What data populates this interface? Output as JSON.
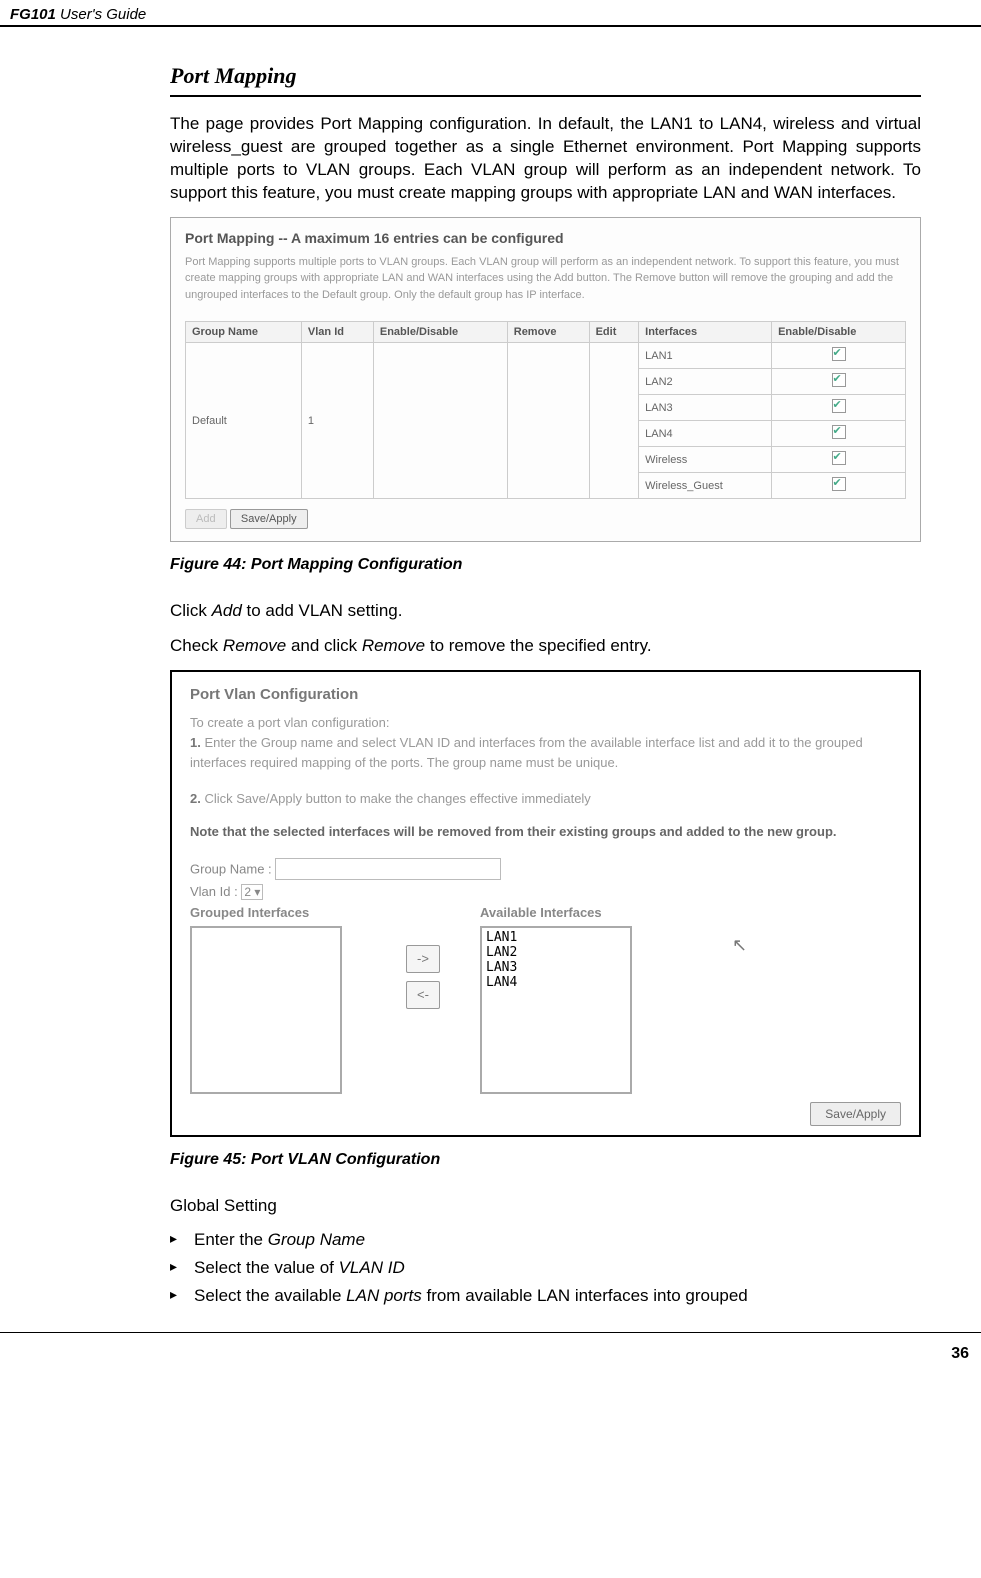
{
  "header": {
    "product": "FG101",
    "book": "User's Guide"
  },
  "section": {
    "heading": "Port Mapping"
  },
  "intro": "The page provides Port Mapping configuration. In default, the LAN1 to LAN4, wireless and virtual wireless_guest are grouped together as a single Ethernet environment. Port Mapping supports multiple ports to VLAN groups. Each VLAN group will perform as an independent network. To support this feature, you must create mapping groups with appropriate LAN and WAN interfaces.",
  "shot1": {
    "title": "Port Mapping -- A maximum 16 entries can be configured",
    "desc": "Port Mapping supports multiple ports to VLAN groups. Each VLAN group will perform as an independent network. To support this feature, you must create mapping groups with appropriate LAN and WAN interfaces using the Add button. The Remove button will remove the grouping and add the ungrouped interfaces to the Default group. Only the default group has IP interface.",
    "columns": [
      "Group Name",
      "Vlan Id",
      "Enable/Disable",
      "Remove",
      "Edit",
      "Interfaces",
      "Enable/Disable"
    ],
    "group_name": "Default",
    "vlan_id": "1",
    "interfaces": [
      "LAN1",
      "LAN2",
      "LAN3",
      "LAN4",
      "Wireless",
      "Wireless_Guest"
    ],
    "add_label": "Add",
    "save_label": "Save/Apply"
  },
  "fig44": "Figure 44: Port Mapping Configuration",
  "mid_text1_a": "Click ",
  "mid_text1_b": "Add",
  "mid_text1_c": " to add VLAN setting.",
  "mid_text2_a": "Check ",
  "mid_text2_b": "Remove",
  "mid_text2_c": " and click ",
  "mid_text2_d": "Remove",
  "mid_text2_e": " to remove the specified entry.",
  "shot2": {
    "title": "Port Vlan Configuration",
    "intro": "To create a port vlan configuration:",
    "step1_num": "1.",
    "step1": " Enter the Group name and select VLAN ID and interfaces from the available interface list and add it to the grouped interfaces required mapping of the ports. The group name must be unique.",
    "step2_num": "2.",
    "step2": " Click Save/Apply button to make the changes effective immediately",
    "note": "Note that the selected interfaces will be removed from their existing groups and added to the new group.",
    "group_label": "Group Name :",
    "vlan_label": "Vlan Id :",
    "vlan_value": "2",
    "grouped_title": "Grouped Interfaces",
    "available_title": "Available Interfaces",
    "available_items": [
      "LAN1",
      "LAN2",
      "LAN3",
      "LAN4"
    ],
    "arrow_right": "->",
    "arrow_left": "<-",
    "save_label": "Save/Apply"
  },
  "fig45": "Figure 45: Port VLAN Configuration",
  "global_setting": "Global Setting",
  "bullets": {
    "b1_a": "Enter the ",
    "b1_b": "Group Name",
    "b2_a": "Select the value of ",
    "b2_b": "VLAN ID",
    "b3_a": "Select the available ",
    "b3_b": "LAN ports",
    "b3_c": " from available LAN interfaces into grouped"
  },
  "page_num": "36"
}
